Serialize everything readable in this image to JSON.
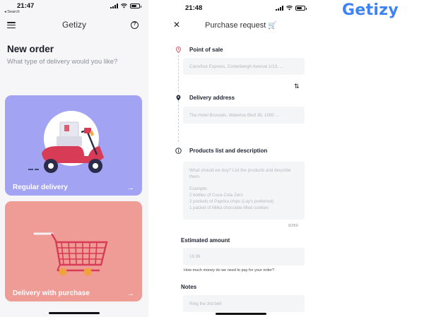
{
  "left_screen": {
    "status": {
      "time": "21:47",
      "back_label": "◂ Search"
    },
    "header": {
      "title": "Getizy",
      "menu_icon": "hamburger-icon",
      "help_icon": "help-icon"
    },
    "heading": "New order",
    "subheading": "What type of delivery would you like?",
    "cards": [
      {
        "label": "Regular delivery",
        "arrow": "→",
        "color": "#a2a3f2",
        "illustration": "scooter-illustration"
      },
      {
        "label": "Delivery with purchase",
        "arrow": "→",
        "color": "#ef9b96",
        "illustration": "shopping-cart-illustration"
      }
    ]
  },
  "right_screen": {
    "status": {
      "time": "21:48"
    },
    "header": {
      "title": "Purchase request",
      "title_icon": "🛒",
      "close": "✕"
    },
    "point_of_sale": {
      "label": "Point of sale",
      "placeholder": "Carrefour Express, Cortenbergh Avenue 1/13, ..."
    },
    "delivery_address": {
      "label": "Delivery address",
      "placeholder": "The Hotel Brussels, Waterloo Blvd 38, 1000 ..."
    },
    "swap_icon": "⇅",
    "products": {
      "label": "Products list and description",
      "placeholder_lines": [
        "What should we buy? List the products and describe",
        "them.",
        "",
        "Example:",
        "2 bottles of Coca-Cola Zero",
        "2 pockets of Paprika chips (Lay's preferred)",
        "1 packet of Milka chocolate-filled cookies"
      ],
      "counter": "0/250"
    },
    "estimated_amount": {
      "label": "Estimated amount",
      "placeholder": "19.99",
      "helper": "How much money do we need to pay for your order?"
    },
    "notes": {
      "label": "Notes",
      "placeholder": "Ring the 3rd bell"
    }
  },
  "brand": {
    "name": "Getizy",
    "color": "#3d82f7"
  }
}
